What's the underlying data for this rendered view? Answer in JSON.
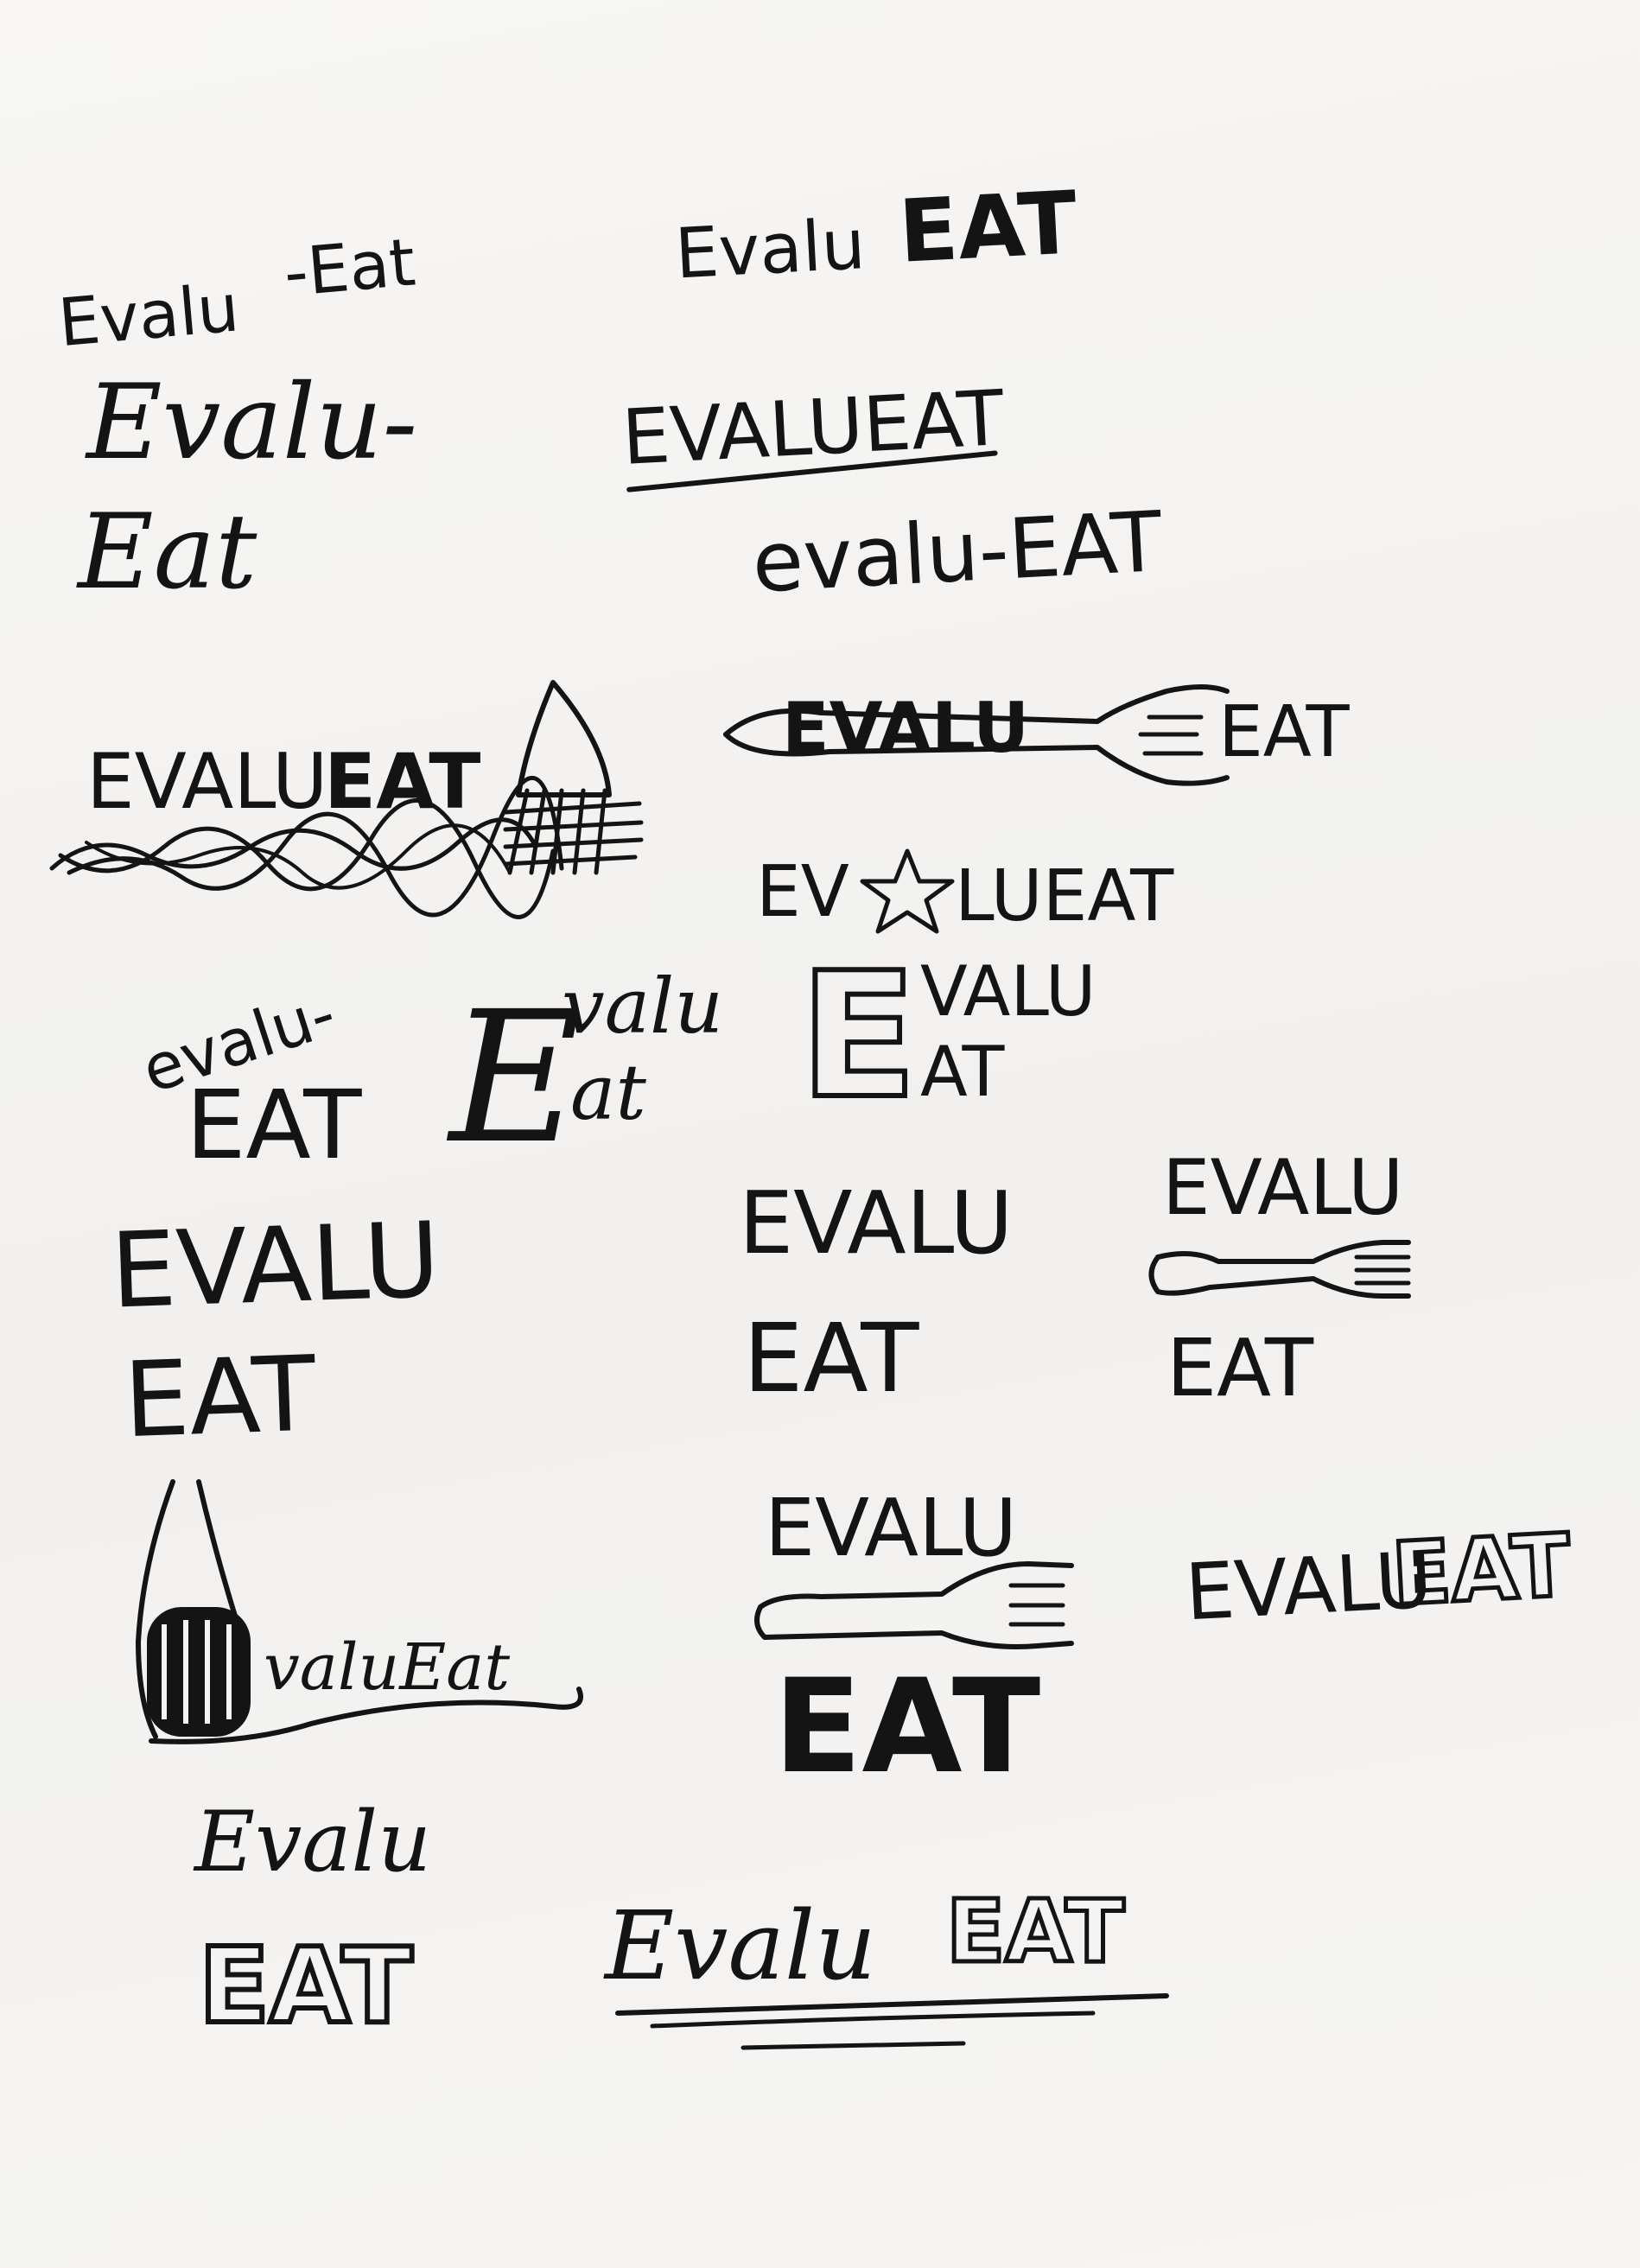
{
  "sketches": {
    "s1": {
      "a": "Evalu",
      "b": "-Eat"
    },
    "s2": {
      "a": "Evalu",
      "b": "EAT"
    },
    "s3": {
      "a": "Evalu-",
      "b": "Eat"
    },
    "s4": {
      "text": "EVALUEAT"
    },
    "s5": {
      "text": "evalu-EAT"
    },
    "s6": {
      "a": "EVALU",
      "b": "EAT"
    },
    "s7": {
      "a": "EVALU",
      "b": "EAT"
    },
    "s8": {
      "a": "EV",
      "b": "LUEAT"
    },
    "s9": {
      "a": "evalu-",
      "b": "EAT"
    },
    "s10": {
      "a": "E",
      "b": "valu",
      "c": "at"
    },
    "s11": {
      "a": "E",
      "b": "VALU",
      "c": "AT"
    },
    "s12": {
      "a": "EVALU",
      "b": "EAT"
    },
    "s13": {
      "a": "EVALU",
      "b": "EAT"
    },
    "s14": {
      "a": "EVALU",
      "b": "EAT"
    },
    "s15": {
      "text": "valuEat"
    },
    "s16": {
      "a": "EVALU",
      "b": "EAT"
    },
    "s17": {
      "a": "EVALU",
      "b": "EAT"
    },
    "s18": {
      "a": "Evalu",
      "b": "EAT"
    },
    "s19": {
      "a": "Evalu",
      "b": "EAT"
    }
  },
  "ink_color": "#141414",
  "paper_color": "#f4f3f1"
}
